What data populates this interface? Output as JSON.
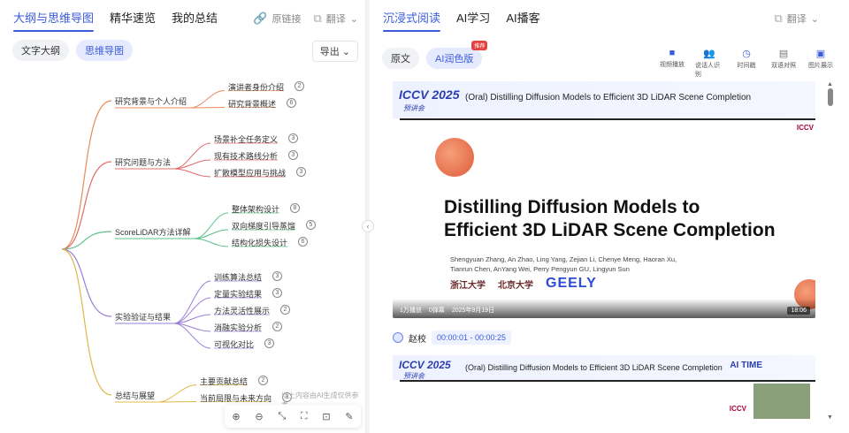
{
  "left": {
    "tabs": [
      "大纲与思维导图",
      "精华速览",
      "我的总结"
    ],
    "tools": {
      "source": "原链接",
      "translate": "翻译"
    },
    "subtabs": [
      "文字大纲",
      "思维导图"
    ],
    "export": "导出",
    "mindmap": {
      "branches": [
        {
          "label": "研究背景与个人介绍",
          "children": [
            {
              "label": "演讲者身份介绍",
              "count": "2"
            },
            {
              "label": "研究背景概述",
              "count": "6"
            }
          ]
        },
        {
          "label": "研究问题与方法",
          "children": [
            {
              "label": "场景补全任务定义",
              "count": "3"
            },
            {
              "label": "现有技术路线分析",
              "count": "3"
            },
            {
              "label": "扩散模型应用与挑战",
              "count": "3"
            }
          ]
        },
        {
          "label": "ScoreLiDAR方法详解",
          "children": [
            {
              "label": "整体架构设计",
              "count": "8"
            },
            {
              "label": "双向梯度引导蒸馏",
              "count": "5"
            },
            {
              "label": "结构化损失设计",
              "count": "6"
            }
          ]
        },
        {
          "label": "实验验证与结果",
          "children": [
            {
              "label": "训练算法总结",
              "count": "3"
            },
            {
              "label": "定量实验结果",
              "count": "3"
            },
            {
              "label": "方法灵活性展示",
              "count": "2"
            },
            {
              "label": "消融实验分析",
              "count": "2"
            },
            {
              "label": "可视化对比",
              "count": "3"
            }
          ]
        },
        {
          "label": "总结与展望",
          "children": [
            {
              "label": "主要贡献总结",
              "count": "2"
            },
            {
              "label": "当前局限与未来方向",
              "count": "3"
            }
          ]
        }
      ],
      "note": "以上内容由AI生成仅供参考",
      "colors": [
        "#e88a5a",
        "#e06b6b",
        "#5cc08a",
        "#9b7fd8",
        "#e0b84a"
      ]
    }
  },
  "right": {
    "tabs": [
      "沉浸式阅读",
      "AI学习",
      "AI播客"
    ],
    "translate": "翻译",
    "subtabs": [
      "原文",
      "AI润色版"
    ],
    "recommend": "推荐",
    "icons": [
      {
        "label": "视频播放",
        "icon": "video-icon"
      },
      {
        "label": "说话人识别",
        "icon": "users-icon"
      },
      {
        "label": "时间戳",
        "icon": "clock-icon"
      },
      {
        "label": "双语对照",
        "icon": "bilingual-icon"
      },
      {
        "label": "图片展示",
        "icon": "image-icon"
      }
    ],
    "video": {
      "conf": "ICCV 2025",
      "conf_sub": "预讲会",
      "title": "(Oral) Distilling Diffusion Models to Efficient 3D LiDAR Scene Completion",
      "slide_title_1": "Distilling Diffusion Models to",
      "slide_title_2": "Efficient 3D LiDAR Scene Completion",
      "authors_1": "Shengyuan Zhang, An Zhao, Ling Yang, Zejian Li, Chenye Meng, Haoran Xu,",
      "authors_2": "Tianrun Chen, AnYang Wei, Perry Pengyun GU, Lingyun Sun",
      "logo1": "浙江大学",
      "logo2": "北京大学",
      "logo3": "GEELY",
      "plays": "1万播放",
      "danmaku": "0弹幕",
      "date": "2025年9月19日",
      "duration": "18:06",
      "mini_logo": "ICCV"
    },
    "speaker": {
      "name": "赵校",
      "time": "00:00:01 - 00:00:25"
    },
    "video2": {
      "conf": "ICCV 2025",
      "conf_sub": "预讲会",
      "title": "(Oral) Distilling Diffusion Models to Efficient 3D LiDAR Scene Completion",
      "aitime": "AI TIME",
      "mini_logo": "ICCV"
    }
  }
}
